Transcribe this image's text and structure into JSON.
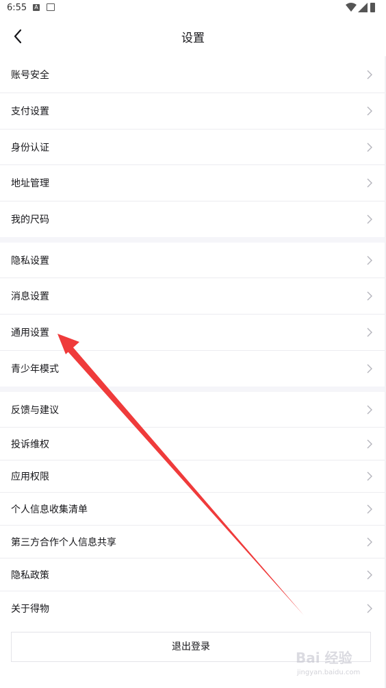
{
  "status_bar": {
    "time": "6:55",
    "badge": "A"
  },
  "header": {
    "title": "设置"
  },
  "groups": [
    {
      "items": [
        "账号安全",
        "支付设置",
        "身份认证",
        "地址管理",
        "我的尺码"
      ]
    },
    {
      "items": [
        "隐私设置",
        "消息设置",
        "通用设置",
        "青少年模式"
      ]
    },
    {
      "items": [
        "反馈与建议",
        "投诉维权",
        "应用权限",
        "个人信息收集清单",
        "第三方合作个人信息共享",
        "隐私政策",
        "关于得物"
      ]
    }
  ],
  "logout_label": "退出登录",
  "annotation": {
    "color": "#ef3b3b",
    "target": "通用设置"
  },
  "watermark": {
    "text": "Bai 经验",
    "url": "jingyan.baidu.com"
  }
}
